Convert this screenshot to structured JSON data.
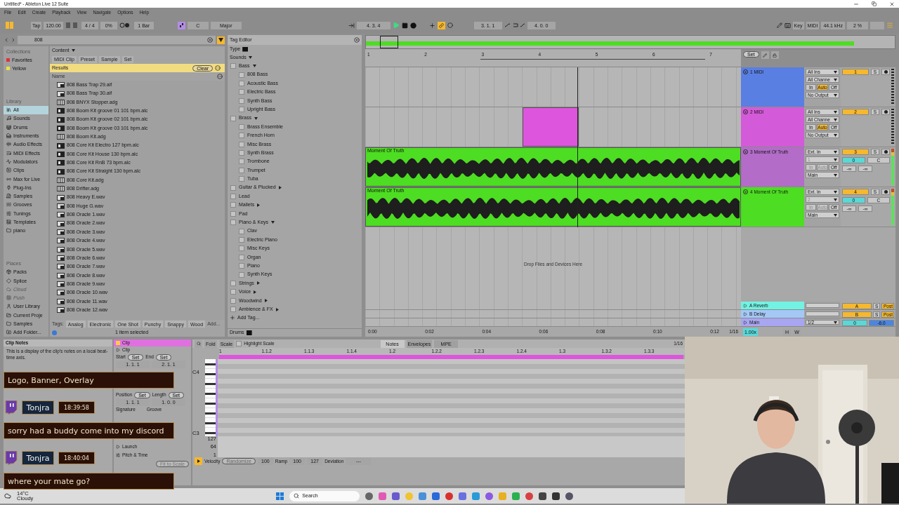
{
  "window": {
    "title": "Untitled* - Ableton Live 12 Suite"
  },
  "menu": [
    "File",
    "Edit",
    "Create",
    "Playback",
    "View",
    "Navigate",
    "Options",
    "Help"
  ],
  "toolbar": {
    "tap": "Tap",
    "tempo": "120.00",
    "signature": "4 / 4",
    "groove": "0%",
    "quantize": "1 Bar",
    "key": "C",
    "scale": "Major",
    "position": "4.  3.  4",
    "loop_start": "3.  1.  1",
    "loop_length": "4.  0.  0",
    "key_map": "Key",
    "midi_map": "MIDI",
    "sample_rate": "44.1 kHz",
    "cpu": "2 %"
  },
  "browser": {
    "search": "808",
    "collections_title": "Collections",
    "collections": [
      {
        "label": "Favorites",
        "color": "#e03040"
      },
      {
        "label": "Yellow",
        "color": "#e8e048"
      }
    ],
    "library_title": "Library",
    "library": [
      {
        "label": "All",
        "selected": true
      },
      {
        "label": "Sounds",
        "selected": false
      },
      {
        "label": "Drums",
        "selected": false
      },
      {
        "label": "Instruments",
        "selected": false
      },
      {
        "label": "Audio Effects",
        "selected": false
      },
      {
        "label": "MIDI Effects",
        "selected": false
      },
      {
        "label": "Modulators",
        "selected": false
      },
      {
        "label": "Clips",
        "selected": false
      },
      {
        "label": "Max for Live",
        "selected": false
      },
      {
        "label": "Plug-Ins",
        "selected": false
      },
      {
        "label": "Samples",
        "selected": false
      },
      {
        "label": "Grooves",
        "selected": false
      },
      {
        "label": "Tunings",
        "selected": false
      },
      {
        "label": "Templates",
        "selected": false
      },
      {
        "label": "piano",
        "selected": false
      }
    ],
    "places_title": "Places",
    "places": [
      {
        "label": "Packs",
        "disabled": false
      },
      {
        "label": "Splice",
        "disabled": false
      },
      {
        "label": "Cloud",
        "disabled": true
      },
      {
        "label": "Push",
        "disabled": true
      },
      {
        "label": "User Library",
        "disabled": false
      },
      {
        "label": "Current Proje",
        "disabled": false
      },
      {
        "label": "Samples",
        "disabled": false
      },
      {
        "label": "Add Folder...",
        "disabled": false
      }
    ],
    "content_label": "Content",
    "filters": [
      "MIDI Clip",
      "Preset",
      "Sample",
      "Set"
    ],
    "results_label": "Results",
    "clear": "Clear",
    "name_header": "Name",
    "files": [
      {
        "name": "808 Bass Trap 29.aif",
        "kind": "sample"
      },
      {
        "name": "808 Bass Trap 30.aif",
        "kind": "sample"
      },
      {
        "name": "808 BNYX Stopper.adg",
        "kind": "rack"
      },
      {
        "name": "808 Boom Kit groove 01  101 bpm.alc",
        "kind": "clip"
      },
      {
        "name": "808 Boom Kit groove 02  101 bpm.alc",
        "kind": "clip"
      },
      {
        "name": "808 Boom Kit groove 03  101 bpm.alc",
        "kind": "clip"
      },
      {
        "name": "808 Boom Kit.adg",
        "kind": "rack"
      },
      {
        "name": "808 Core Kit Electro 127 bpm.alc",
        "kind": "clip"
      },
      {
        "name": "808 Core Kit House 130 bpm.alc",
        "kind": "clip"
      },
      {
        "name": "808 Core Kit RnB 73 bpm.alc",
        "kind": "clip"
      },
      {
        "name": "808 Core Kit Straight 130 bpm.alc",
        "kind": "clip"
      },
      {
        "name": "808 Core Kit.adg",
        "kind": "rack"
      },
      {
        "name": "808 Drifter.adg",
        "kind": "rack"
      },
      {
        "name": "808 Heavy E.wav",
        "kind": "sample"
      },
      {
        "name": "808 Huge G.wav",
        "kind": "sample"
      },
      {
        "name": "808 Oracle 1.wav",
        "kind": "sample"
      },
      {
        "name": "808 Oracle 2.wav",
        "kind": "sample"
      },
      {
        "name": "808 Oracle 3.wav",
        "kind": "sample"
      },
      {
        "name": "808 Oracle 4.wav",
        "kind": "sample"
      },
      {
        "name": "808 Oracle 5.wav",
        "kind": "sample"
      },
      {
        "name": "808 Oracle 6.wav",
        "kind": "sample"
      },
      {
        "name": "808 Oracle 7.wav",
        "kind": "sample"
      },
      {
        "name": "808 Oracle 8.wav",
        "kind": "sample"
      },
      {
        "name": "808 Oracle 9.wav",
        "kind": "sample"
      },
      {
        "name": "808 Oracle 10.wav",
        "kind": "sample"
      },
      {
        "name": "808 Oracle 11.wav",
        "kind": "sample"
      },
      {
        "name": "808 Oracle 12.wav",
        "kind": "sample"
      }
    ],
    "tags_label": "Tags:",
    "tags": [
      "Analog",
      "Electronic",
      "One Shot",
      "Punchy",
      "Snappy",
      "Wood"
    ],
    "add_tag": "Add...",
    "status": "1 item selected"
  },
  "tag_editor": {
    "title": "Tag Editor",
    "type_label": "Type",
    "sounds_label": "Sounds",
    "tags": [
      {
        "label": "Bass",
        "checked": false,
        "expanded": true,
        "children": [
          {
            "label": "808 Bass",
            "checked": false
          },
          {
            "label": "Acoustic Bass",
            "checked": false
          },
          {
            "label": "Electric Bass",
            "checked": false
          },
          {
            "label": "Synth Bass",
            "checked": false
          },
          {
            "label": "Upright Bass",
            "checked": false
          }
        ]
      },
      {
        "label": "Brass",
        "checked": false,
        "expanded": true,
        "children": [
          {
            "label": "Brass Ensemble",
            "checked": false
          },
          {
            "label": "French Horn",
            "checked": false
          },
          {
            "label": "Misc Brass",
            "checked": false
          },
          {
            "label": "Synth Brass",
            "checked": false
          },
          {
            "label": "Trombone",
            "checked": false
          },
          {
            "label": "Trumpet",
            "checked": false
          },
          {
            "label": "Tuba",
            "checked": false
          }
        ]
      },
      {
        "label": "Guitar & Plucked",
        "checked": false,
        "expanded": false
      },
      {
        "label": "Lead",
        "checked": false
      },
      {
        "label": "Mallets",
        "checked": false,
        "expanded": false
      },
      {
        "label": "Pad",
        "checked": false
      },
      {
        "label": "Piano & Keys",
        "checked": false,
        "expanded": true,
        "children": [
          {
            "label": "Clav",
            "checked": false
          },
          {
            "label": "Electric Piano",
            "checked": false
          },
          {
            "label": "Misc Keys",
            "checked": false
          },
          {
            "label": "Organ",
            "checked": false
          },
          {
            "label": "Piano",
            "checked": false
          },
          {
            "label": "Synth Keys",
            "checked": false
          }
        ]
      },
      {
        "label": "Strings",
        "checked": false,
        "expanded": false
      },
      {
        "label": "Voice",
        "checked": false,
        "expanded": false
      },
      {
        "label": "Woodwind",
        "checked": false,
        "expanded": false
      },
      {
        "label": "Ambience & FX",
        "checked": false,
        "expanded": false
      }
    ],
    "add_tag": "Add Tag...",
    "drums_label": "Drums"
  },
  "arrangement": {
    "ruler": [
      "1",
      "2",
      "3",
      "4",
      "5",
      "6",
      "7"
    ],
    "set": "Set",
    "tracks": [
      {
        "name": "1 MIDI",
        "color": "#5a7fe2",
        "kind": "midi",
        "input": "All Ins",
        "channel": "All Channe",
        "channel_disabled": false,
        "monitor": [
          {
            "label": "In",
            "selected": false,
            "disabled": false
          },
          {
            "label": "Auto",
            "selected": true,
            "disabled": false
          },
          {
            "label": "Off",
            "selected": false,
            "disabled": false
          }
        ],
        "output": "No Output",
        "number": "1",
        "solo": "S"
      },
      {
        "name": "2 MIDI",
        "color": "#d35ad8",
        "kind": "midi",
        "input": "All Ins",
        "channel": "All Channe",
        "channel_disabled": false,
        "monitor": [
          {
            "label": "In",
            "selected": false,
            "disabled": false
          },
          {
            "label": "Auto",
            "selected": true,
            "disabled": false
          },
          {
            "label": "Off",
            "selected": false,
            "disabled": false
          }
        ],
        "output": "No Output",
        "number": "2",
        "solo": "S",
        "clip": {
          "color": "#dd55dd"
        }
      },
      {
        "name": "3 Moment Of Truth",
        "color": "#b36cc8",
        "kind": "audio",
        "input": "Ext. In",
        "channel": "1",
        "channel_disabled": true,
        "monitor": [
          {
            "label": "In",
            "selected": false,
            "disabled": true
          },
          {
            "label": "Auto",
            "selected": false,
            "disabled": true
          },
          {
            "label": "Off",
            "selected": false,
            "disabled": false
          }
        ],
        "output": "Main",
        "number": "3",
        "solo": "S",
        "volume": "0",
        "pan": "C",
        "sends": [
          "-∞",
          "-∞"
        ],
        "clip": {
          "name": "Moment Of Truth",
          "color": "#4ddd22"
        }
      },
      {
        "name": "4 Moment Of Truth",
        "color": "#4ddd22",
        "kind": "audio",
        "input": "Ext. In",
        "channel": "2",
        "channel_disabled": true,
        "monitor": [
          {
            "label": "In",
            "selected": false,
            "disabled": true
          },
          {
            "label": "Auto",
            "selected": false,
            "disabled": true
          },
          {
            "label": "Off",
            "selected": false,
            "disabled": false
          }
        ],
        "output": "Main",
        "number": "4",
        "solo": "S",
        "volume": "0",
        "pan": "C",
        "sends": [
          "-∞",
          "-∞"
        ],
        "clip": {
          "name": "Moment Of Truth",
          "color": "#4ddd22"
        }
      }
    ],
    "drop_hint": "Drop Files and Devices Here",
    "returns": [
      {
        "name": "A Reverb",
        "color": "#72f2e2",
        "letter": "A",
        "solo": "S",
        "post": "Post"
      },
      {
        "name": "B Delay",
        "color": "#a4c8f6",
        "letter": "B",
        "solo": "S",
        "post": "Post"
      }
    ],
    "main": {
      "name": "Main",
      "color": "#a8a6f0",
      "output": "1/2",
      "volume": "0",
      "level": "-6.0"
    },
    "time_ruler": [
      "0:00",
      "0:02",
      "0:04",
      "0:06",
      "0:08",
      "0:10",
      "0:12"
    ],
    "grid": "1/16",
    "zoom": "1.00x",
    "h": "H",
    "w": "W"
  },
  "detail": {
    "grid": "1/16",
    "clip_notes": {
      "title": "Clip Notes",
      "text": "This is a display of the clip's notes on a local beat-time axis."
    },
    "clip": {
      "header": "Clip",
      "section": "Clip",
      "start": "Start",
      "end": "End",
      "set_start": "Set",
      "set_end": "Set",
      "set_position": "Set",
      "set_length": "Set",
      "start_value": "1.  1.  1",
      "end_value": "2.  1.  1",
      "position": "Position",
      "length": "Length",
      "position_value": "1.  1.  1",
      "length_value": "1.  0.  0",
      "signature": "Signature",
      "groove": "Groove",
      "launch": "Launch",
      "pitch_time": "Pitch & Time",
      "fit": "Fit to Scale"
    },
    "piano_roll": {
      "fold": "Fold",
      "scale": "Scale",
      "highlight_scale": {
        "label": "Highlight Scale",
        "checked": false
      },
      "tabs": [
        {
          "label": "Notes",
          "selected": true
        },
        {
          "label": "Envelopes",
          "selected": false
        },
        {
          "label": "MPE",
          "selected": false
        }
      ],
      "ruler": [
        "1",
        "1.1.2",
        "1.1.3",
        "1.1.4",
        "1.2",
        "1.2.2",
        "1.2.3",
        "1.2.4",
        "1.3",
        "1.3.2",
        "1.3.3"
      ],
      "keys": [
        "C4",
        "C3"
      ],
      "velocity_ticks": [
        "127",
        "64",
        "1"
      ],
      "velocity_label": "Velocity",
      "randomize": "Randomize",
      "velocity": "100",
      "ramp_label": "Ramp",
      "ramp_from": "100",
      "ramp_to": "127",
      "deviation_label": "Deviation",
      "deviation": "---"
    }
  },
  "chat": [
    {
      "kind": "message",
      "text": "Logo, Banner, Overlay"
    },
    {
      "kind": "user",
      "name": "Tonjra",
      "time": "18:39:58"
    },
    {
      "kind": "message",
      "text": "sorry had a buddy come into my discord"
    },
    {
      "kind": "user",
      "name": "Tonjra",
      "time": "18:40:04"
    },
    {
      "kind": "message",
      "text": "where your mate go?"
    }
  ],
  "taskbar": {
    "temperature": "14°C",
    "weather": "Cloudy",
    "search": "Search"
  }
}
